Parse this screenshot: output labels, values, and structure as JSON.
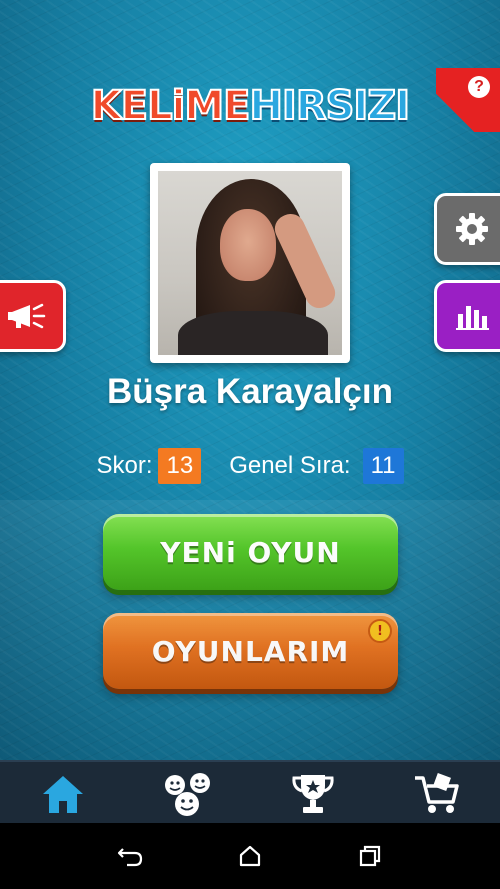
{
  "app": {
    "logo_part1": "KELiME",
    "logo_part2": "HIRSIZI"
  },
  "help": {
    "label": "?"
  },
  "profile": {
    "name": "Büşra Karayalçın",
    "score_label": "Skor:",
    "score_value": "13",
    "rank_label": "Genel Sıra:",
    "rank_value": "11"
  },
  "buttons": {
    "new_game": "YENi OYUN",
    "my_games": "OYUNLARIM",
    "my_games_alert": "!"
  },
  "side_buttons": {
    "announce_icon": "megaphone-icon",
    "settings_icon": "gear-icon",
    "stats_icon": "bar-chart-icon"
  },
  "bottom_nav": [
    {
      "icon": "home-icon",
      "active": true,
      "color": "#2aa7e0"
    },
    {
      "icon": "friends-icon",
      "active": false,
      "color": "#ffffff"
    },
    {
      "icon": "trophy-icon",
      "active": false,
      "color": "#ffffff"
    },
    {
      "icon": "shop-cart-icon",
      "active": false,
      "color": "#ffffff"
    }
  ],
  "system_nav": [
    "back-icon",
    "home-outline-icon",
    "recents-icon"
  ]
}
